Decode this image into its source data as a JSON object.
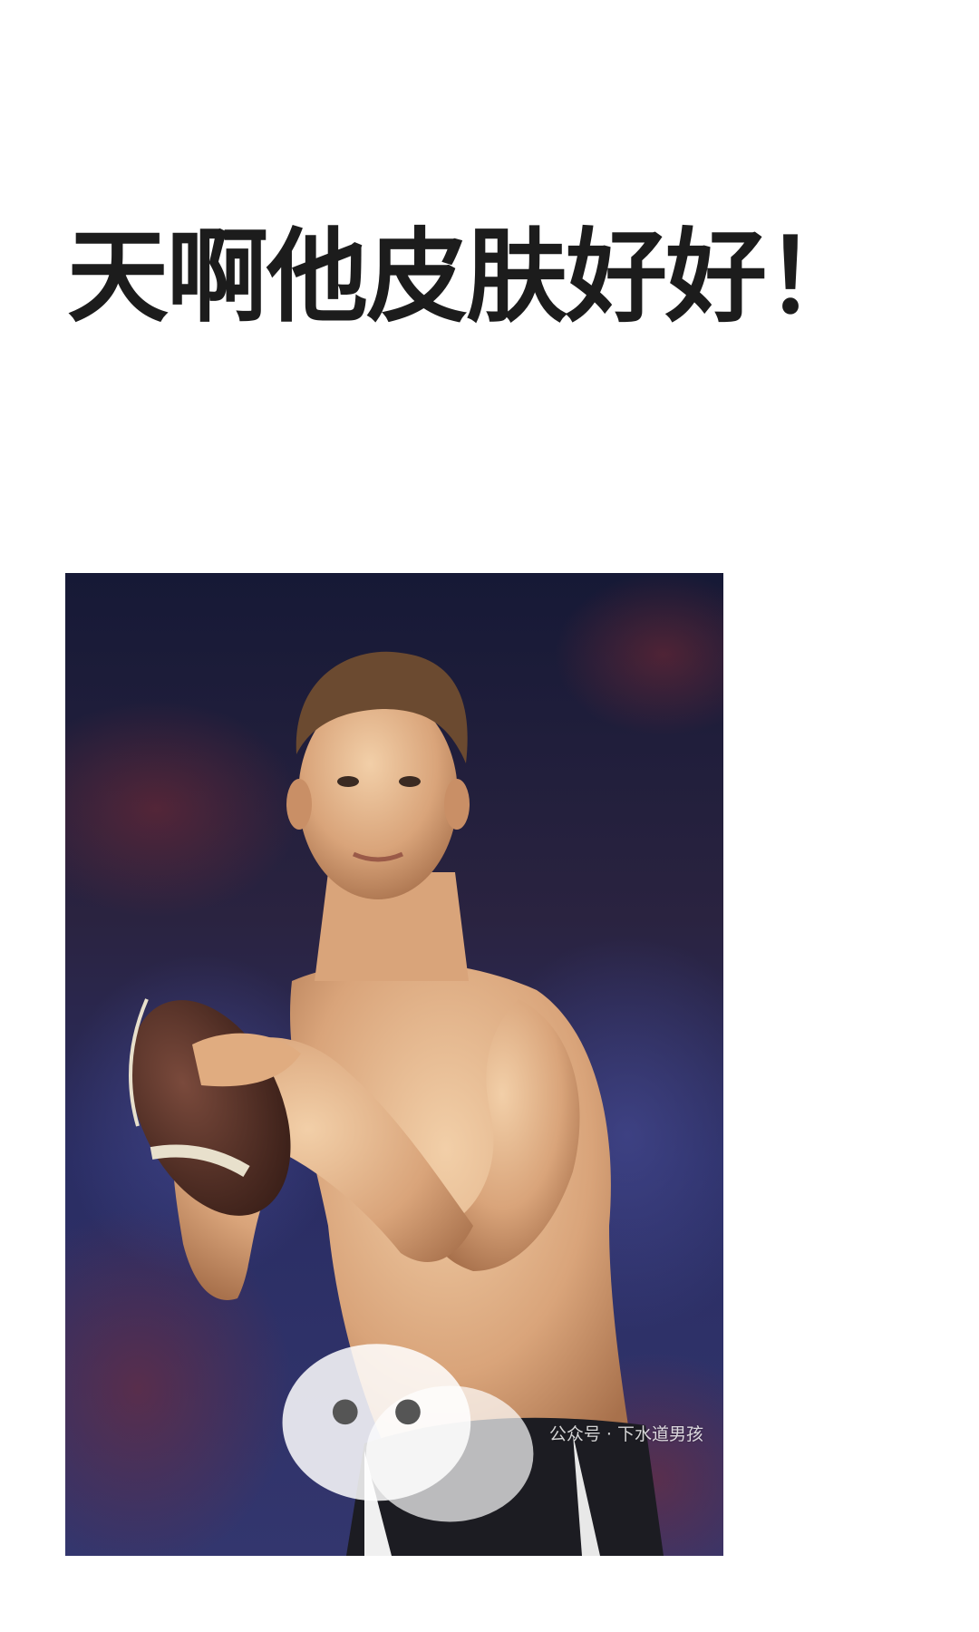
{
  "post": {
    "headline": "天啊他皮肤好好！"
  },
  "photo": {
    "watermark": {
      "icon": "wechat-icon",
      "text": "公众号 · 下水道男孩"
    }
  }
}
